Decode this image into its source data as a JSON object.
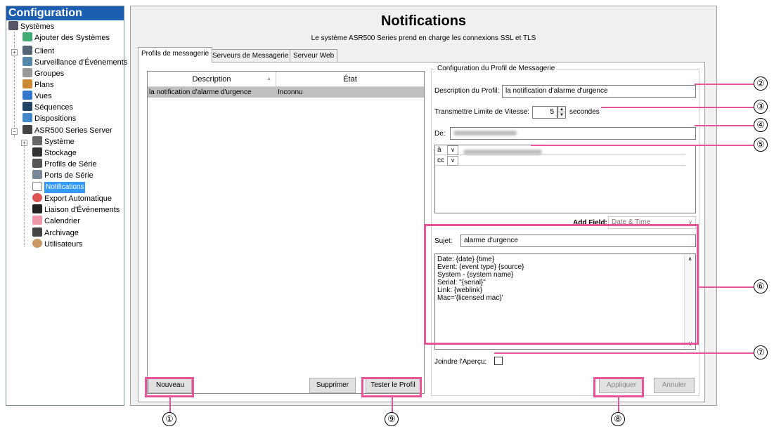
{
  "left_panel": {
    "header": "Configuration",
    "items": [
      {
        "label": "Systèmes",
        "icon": "systems-icon"
      },
      {
        "label": "Ajouter des Systèmes",
        "icon": "add-system-icon"
      },
      {
        "label": "Client",
        "icon": "client-icon"
      },
      {
        "label": "Surveillance d'Événements",
        "icon": "event-monitor-icon"
      },
      {
        "label": "Groupes",
        "icon": "groups-icon"
      },
      {
        "label": "Plans",
        "icon": "plans-icon"
      },
      {
        "label": "Vues",
        "icon": "views-icon"
      },
      {
        "label": "Séquences",
        "icon": "sequences-icon"
      },
      {
        "label": "Dispositions",
        "icon": "layouts-icon"
      },
      {
        "label": "ASR500 Series Server",
        "icon": "server-icon"
      },
      {
        "label": "Système",
        "icon": "system-icon"
      },
      {
        "label": "Stockage",
        "icon": "storage-icon"
      },
      {
        "label": "Profils de Série",
        "icon": "serial-profiles-icon"
      },
      {
        "label": "Ports de Série",
        "icon": "serial-ports-icon"
      },
      {
        "label": "Notifications",
        "icon": "envelope-icon"
      },
      {
        "label": "Export Automatique",
        "icon": "auto-export-icon"
      },
      {
        "label": "Liaison d'Événements",
        "icon": "event-link-icon"
      },
      {
        "label": "Calendrier",
        "icon": "calendar-icon"
      },
      {
        "label": "Archivage",
        "icon": "archive-icon"
      },
      {
        "label": "Utilisateurs",
        "icon": "users-icon"
      }
    ]
  },
  "main": {
    "title": "Notifications",
    "subtitle": "Le système ASR500 Series prend en charge les connexions SSL et TLS",
    "tabs": [
      "Profils de messagerie",
      "Serveurs de Messagerie",
      "Serveur Web"
    ],
    "table": {
      "headers": [
        "Description",
        "État"
      ],
      "rows": [
        [
          "la notification d'alarme d'urgence",
          "Inconnu"
        ]
      ]
    },
    "buttons": {
      "new": "Nouveau",
      "delete": "Supprimer",
      "test": "Tester le Profil",
      "apply": "Appliquer",
      "cancel": "Annuler"
    },
    "profile": {
      "group_title": "Configuration du Profil de Messagerie",
      "desc_label": "Description du Profil:",
      "desc_value": "la notification d'alarme d'urgence",
      "rate_label": "Transmettre Limite de Vitesse:",
      "rate_value": "5",
      "rate_unit": "secondes",
      "from_label": "De:",
      "recipients": [
        {
          "type": "à"
        },
        {
          "type": "cc"
        }
      ],
      "add_field_label": "Add Field:",
      "add_field_value": "Date & Time",
      "subject_label": "Sujet:",
      "subject_value": "alarme d'urgence",
      "body_lines": [
        "Date: {date} {time}",
        "Event: {event type} {source}",
        "System - {system name}",
        "Serial: \"{serial}\"",
        "Link: {weblink}",
        "Mac='{licensed mac}'"
      ],
      "attach_label": "Joindre l'Aperçu:"
    }
  },
  "callouts": [
    "①",
    "②",
    "③",
    "④",
    "⑤",
    "⑥",
    "⑦",
    "⑧",
    "⑨"
  ],
  "colors": {
    "accent": "#1c5fb0",
    "highlight": "#e8549a",
    "selection": "#3399ff"
  }
}
